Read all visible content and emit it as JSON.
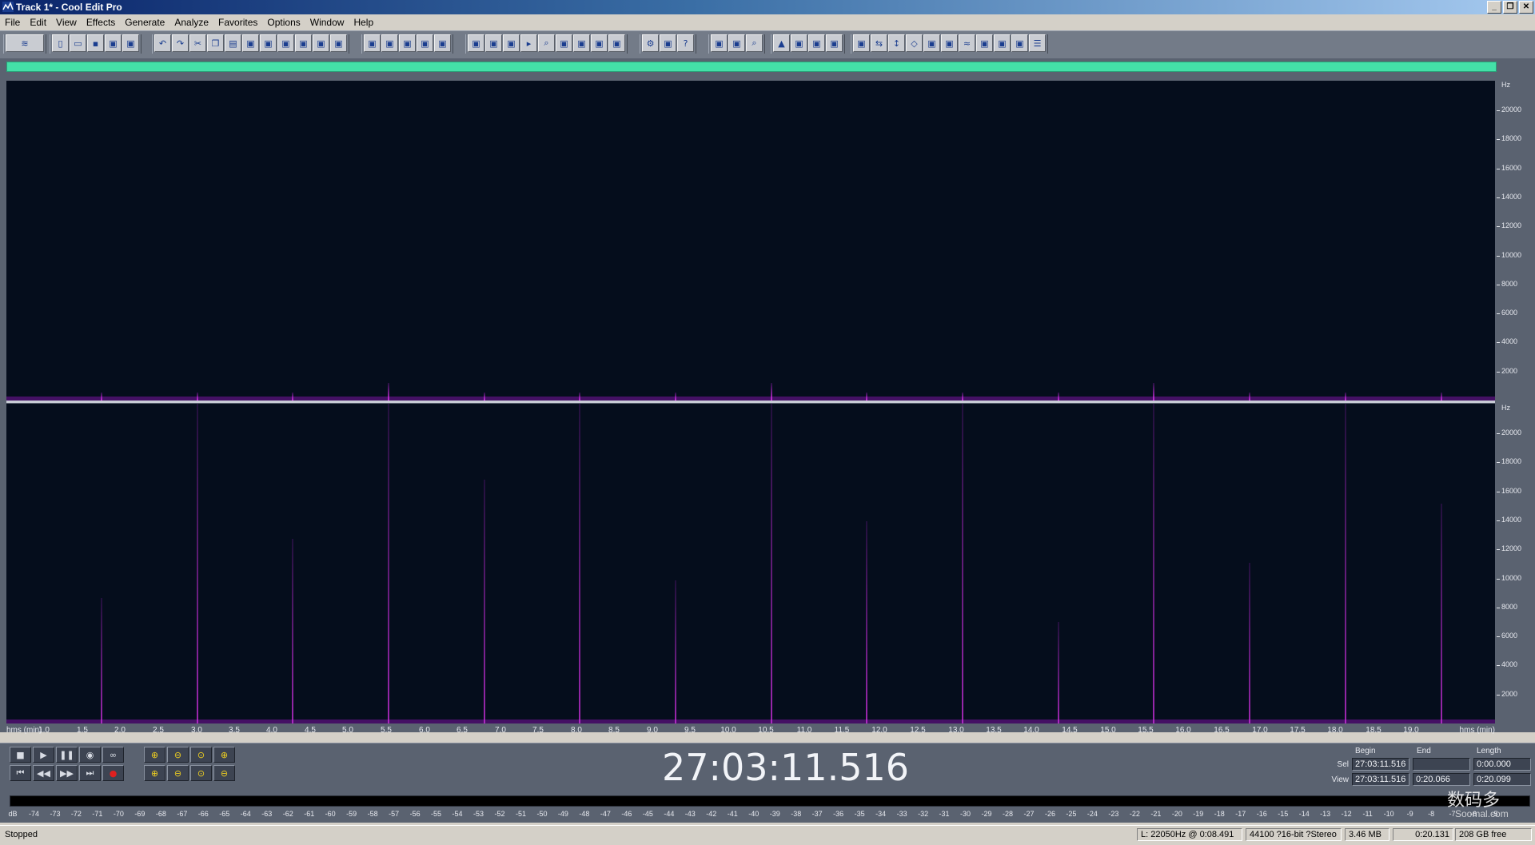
{
  "window": {
    "title": "Track 1* - Cool Edit Pro",
    "controls": [
      "minimize-icon",
      "restore-icon",
      "close-icon"
    ]
  },
  "menu": [
    "File",
    "Edit",
    "View",
    "Effects",
    "Generate",
    "Analyze",
    "Favorites",
    "Options",
    "Window",
    "Help"
  ],
  "toolbar_icons": {
    "group1": [
      "waveform-toggle-icon"
    ],
    "group2": [
      "new-file-icon",
      "open-file-icon",
      "save-icon",
      "save-all-icon",
      "close-file-icon"
    ],
    "group3": [
      "undo-icon",
      "redo-icon",
      "cut-icon",
      "copy-icon",
      "paste-icon",
      "trim-icon",
      "mix-paste-icon",
      "insert-icon",
      "silence-icon",
      "save-selection-icon",
      "paste-new-icon"
    ],
    "group4": [
      "envelope-icon",
      "selection-icon",
      "grid-icon",
      "snap-icon",
      "grid-alt-icon"
    ],
    "group5": [
      "view-wave-icon",
      "view-spectral-icon",
      "view-mixed-icon",
      "play-cue-icon",
      "zoom-icon",
      "timecode-icon",
      "cue-list-icon",
      "markers-icon",
      "levels-icon"
    ],
    "group6": [
      "settings-icon",
      "tips-icon",
      "help-icon"
    ],
    "group7": [
      "track-view-icon",
      "frequency-analysis-icon",
      "search-icon"
    ],
    "group8": [
      "amplify-icon",
      "normalize-icon",
      "fade-icon",
      "delay-icon"
    ],
    "group9": [
      "filter-icon",
      "reverse-icon",
      "invert-icon",
      "center-icon",
      "stretch-icon",
      "noise-reduction-icon",
      "echo-icon",
      "eq-icon",
      "compressor-icon",
      "flanger-icon",
      "properties-icon"
    ]
  },
  "frequency_axis": {
    "unit": "Hz",
    "ticks": [
      "20000",
      "18000",
      "16000",
      "14000",
      "12000",
      "10000",
      "8000",
      "6000",
      "4000",
      "2000"
    ]
  },
  "time_ruler": {
    "unit_label_left": "hms (min)",
    "unit_label_right": "hms (min)",
    "ticks": [
      "1.0",
      "1.5",
      "2.0",
      "2.5",
      "3.0",
      "3.5",
      "4.0",
      "4.5",
      "5.0",
      "5.5",
      "6.0",
      "6.5",
      "7.0",
      "7.5",
      "8.0",
      "8.5",
      "9.0",
      "9.5",
      "10.0",
      "10.5",
      "11.0",
      "11.5",
      "12.0",
      "12.5",
      "13.0",
      "13.5",
      "14.0",
      "14.5",
      "15.0",
      "15.5",
      "16.0",
      "16.5",
      "17.0",
      "17.5",
      "18.0",
      "18.5",
      "19.0"
    ]
  },
  "transport": {
    "row1": [
      {
        "name": "stop-button",
        "glyph": "■"
      },
      {
        "name": "play-button",
        "glyph": "▶"
      },
      {
        "name": "pause-button",
        "glyph": "❚❚"
      },
      {
        "name": "play-to-end-button",
        "glyph": "◉"
      },
      {
        "name": "loop-button",
        "glyph": "∞"
      }
    ],
    "row2": [
      {
        "name": "go-to-start-button",
        "glyph": "⏮"
      },
      {
        "name": "rewind-button",
        "glyph": "◀◀"
      },
      {
        "name": "fast-forward-button",
        "glyph": "▶▶"
      },
      {
        "name": "go-to-end-button",
        "glyph": "⏭"
      },
      {
        "name": "record-button",
        "glyph": "●"
      }
    ],
    "zoom_row1": [
      {
        "name": "zoom-in-horizontal-button",
        "glyph": "⊕"
      },
      {
        "name": "zoom-out-horizontal-button",
        "glyph": "⊖"
      },
      {
        "name": "zoom-full-button",
        "glyph": "⊙"
      },
      {
        "name": "zoom-in-vertical-button",
        "glyph": "⊕"
      }
    ],
    "zoom_row2": [
      {
        "name": "zoom-left-button",
        "glyph": "⊕"
      },
      {
        "name": "zoom-right-button",
        "glyph": "⊖"
      },
      {
        "name": "zoom-selection-button",
        "glyph": "⊙"
      },
      {
        "name": "zoom-out-vertical-button",
        "glyph": "⊖"
      }
    ],
    "timecode": "27:03:11.516"
  },
  "selection": {
    "headers": {
      "begin": "Begin",
      "end": "End",
      "length": "Length"
    },
    "sel": {
      "label": "Sel",
      "begin": "27:03:11.516",
      "end": "",
      "length": "0:00.000"
    },
    "view": {
      "label": "View",
      "begin": "27:03:11.516",
      "end": "0:20.066",
      "length": "0:20.099"
    }
  },
  "level_meter": {
    "ticks": [
      "dB",
      "-74",
      "-73",
      "-72",
      "-71",
      "-70",
      "-69",
      "-68",
      "-67",
      "-66",
      "-65",
      "-64",
      "-63",
      "-62",
      "-61",
      "-60",
      "-59",
      "-58",
      "-57",
      "-56",
      "-55",
      "-54",
      "-53",
      "-52",
      "-51",
      "-50",
      "-49",
      "-48",
      "-47",
      "-46",
      "-45",
      "-44",
      "-43",
      "-42",
      "-41",
      "-40",
      "-39",
      "-38",
      "-37",
      "-36",
      "-35",
      "-34",
      "-33",
      "-32",
      "-31",
      "-30",
      "-29",
      "-28",
      "-27",
      "-26",
      "-25",
      "-24",
      "-23",
      "-22",
      "-21",
      "-20",
      "-19",
      "-18",
      "-17",
      "-16",
      "-15",
      "-14",
      "-13",
      "-12",
      "-11",
      "-10",
      "-9",
      "-8",
      "-7",
      "-6",
      "-5"
    ]
  },
  "status": {
    "state": "Stopped",
    "cursor": "L: 22050Hz @",
    "cursor_time": "0:08.491",
    "format": "44100 ?16-bit ?Stereo",
    "size": "3.46 MB",
    "duration": "0:20.131",
    "free": "208 GB free"
  },
  "watermark": {
    "main": "数码多",
    "sub": "Soomal.com"
  },
  "colors": {
    "spectrum_bg": "#050d1c",
    "spike": "#d030e0",
    "range_bar": "#44e0a8",
    "panel": "#5a6270"
  }
}
